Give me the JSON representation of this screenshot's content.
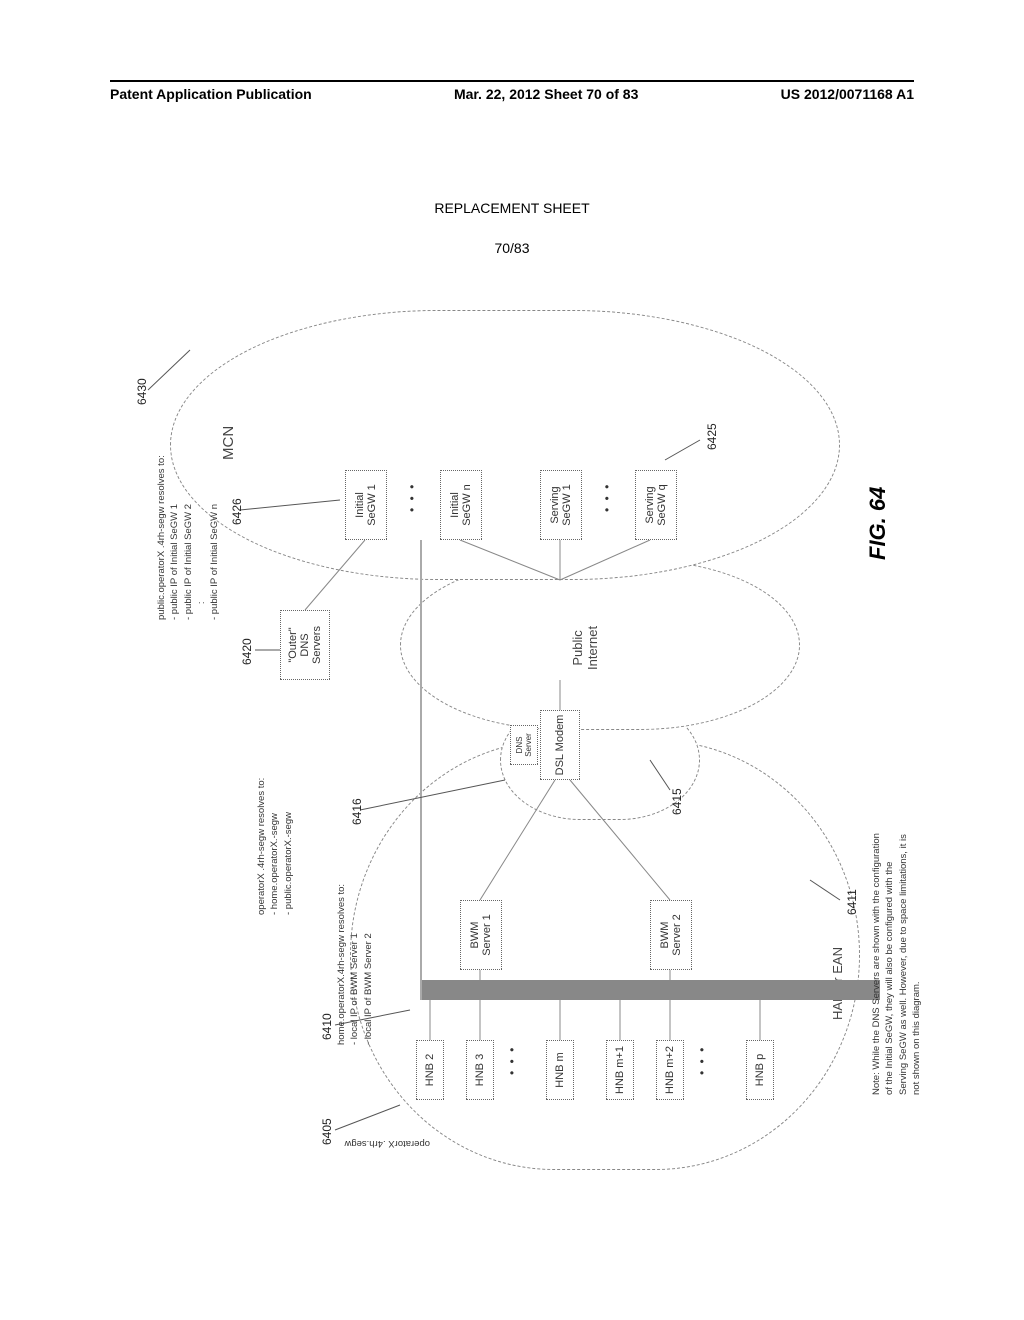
{
  "header": {
    "left": "Patent Application Publication",
    "center": "Mar. 22, 2012  Sheet 70 of 83",
    "right": "US 2012/0071168 A1"
  },
  "replacement_label": "REPLACEMENT SHEET",
  "sheet_number": "70/83",
  "figure_label": "FIG. 64",
  "clouds": {
    "han": "HAN or EAN",
    "internet": "Public\nInternet",
    "mcn": "MCN"
  },
  "nodes": {
    "hnb": [
      "HNB 2",
      "HNB 3",
      "HNB m",
      "HNB m+1",
      "HNB m+2",
      "HNB p"
    ],
    "bwm": [
      "BWM\nServer 1",
      "BWM\nServer 2"
    ],
    "segw_initial": [
      "Initial\nSeGW 1",
      "Initial\nSeGW n"
    ],
    "segw_serving": [
      "Serving\nSeGW 1",
      "Serving\nSeGW q"
    ],
    "dns_outer": "\"Outer\"\nDNS\nServers",
    "dsl_modem": "DSL Modem",
    "dns_server": "DNS\nServer"
  },
  "annotations": {
    "a1_label": "operatorX .4rh.segw",
    "a2": "operatorX .4rh-segw resolves to:\n- home.operatorX.-segw\n- public.operatorX.-segw",
    "a3": "home.operatorX.4rh-segw resolves to:\n- local IP of BWM Server 1\n- local IP of BWM Server 2",
    "a4": "public.operatorX .4rh-segw resolves to:\n- public IP of Initial SeGW 1\n- public IP of Initial SeGW 2\n      :\n- public IP of Initial SeGW n",
    "note": "Note: While the DNS Servers are shown with the configuration\nof the Initial SeGW, they will also be configured with the\nServing SeGW as well. However, due to space limitations, it is\nnot shown on this diagram."
  },
  "refs": {
    "r6405": "6405",
    "r6410": "6410",
    "r6411": "6411",
    "r6415": "6415",
    "r6416": "6416",
    "r6420": "6420",
    "r6425": "6425",
    "r6426": "6426",
    "r6430": "6430"
  }
}
